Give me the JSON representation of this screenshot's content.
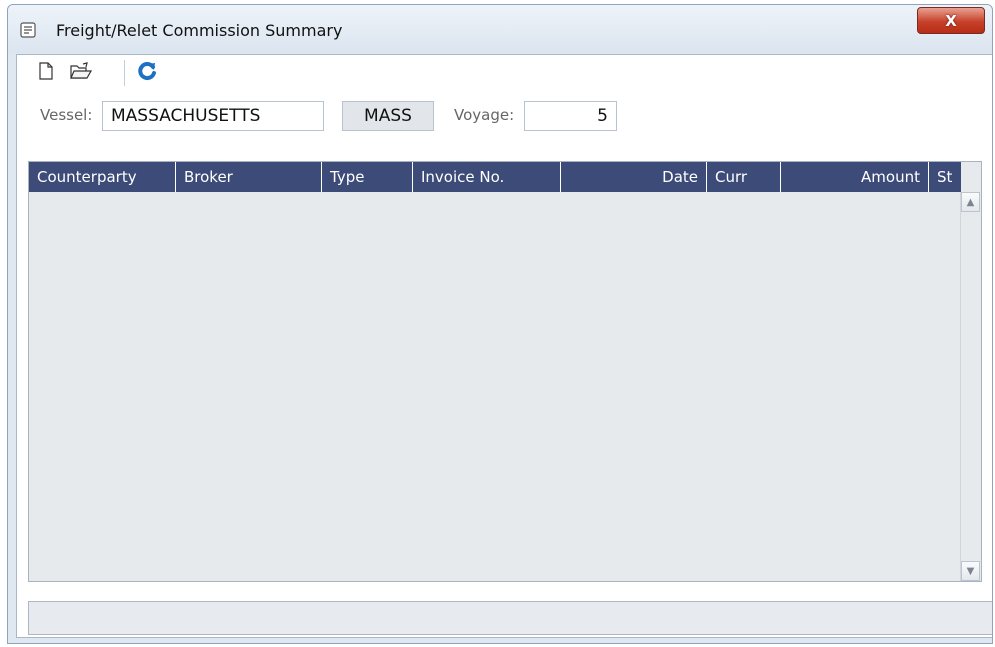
{
  "window": {
    "title": "Freight/Relet Commission Summary",
    "close_label": "X"
  },
  "toolbar": {
    "icons": [
      "new-document-icon",
      "open-folder-icon",
      "refresh-icon"
    ]
  },
  "form": {
    "vessel_label": "Vessel:",
    "vessel_value": "MASSACHUSETTS",
    "vessel_code": "MASS",
    "voyage_label": "Voyage:",
    "voyage_value": "5"
  },
  "grid": {
    "columns": [
      "Counterparty",
      "Broker",
      "Type",
      "Invoice No.",
      "Date",
      "Curr",
      "Amount",
      "St"
    ],
    "rows": []
  },
  "colors": {
    "header_bg": "#3d4b79",
    "window_bg": "#dfe7f1",
    "grid_bg": "#e6eaed",
    "refresh_icon": "#1f6fc2",
    "close_button": "#c7412a"
  }
}
